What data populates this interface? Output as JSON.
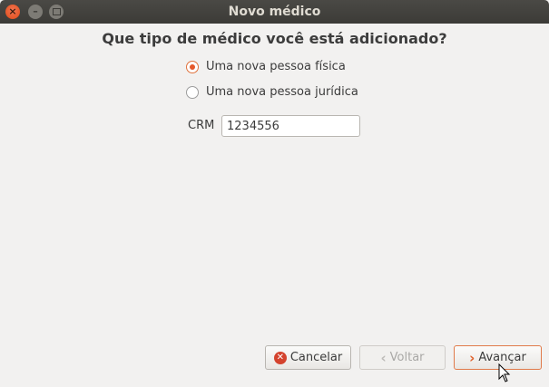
{
  "window": {
    "title": "Novo médico"
  },
  "heading": "Que tipo de médico você está adicionado?",
  "options": [
    {
      "label": "Uma nova pessoa física",
      "checked": true
    },
    {
      "label": "Uma nova pessoa jurídica",
      "checked": false
    }
  ],
  "crm": {
    "label": "CRM",
    "value": "1234556"
  },
  "buttons": {
    "cancel": "Cancelar",
    "back": "Voltar",
    "next": "Avançar"
  },
  "colors": {
    "accent": "#e5582a",
    "titlebar": "#3c3b37",
    "background": "#f2f1f0"
  }
}
